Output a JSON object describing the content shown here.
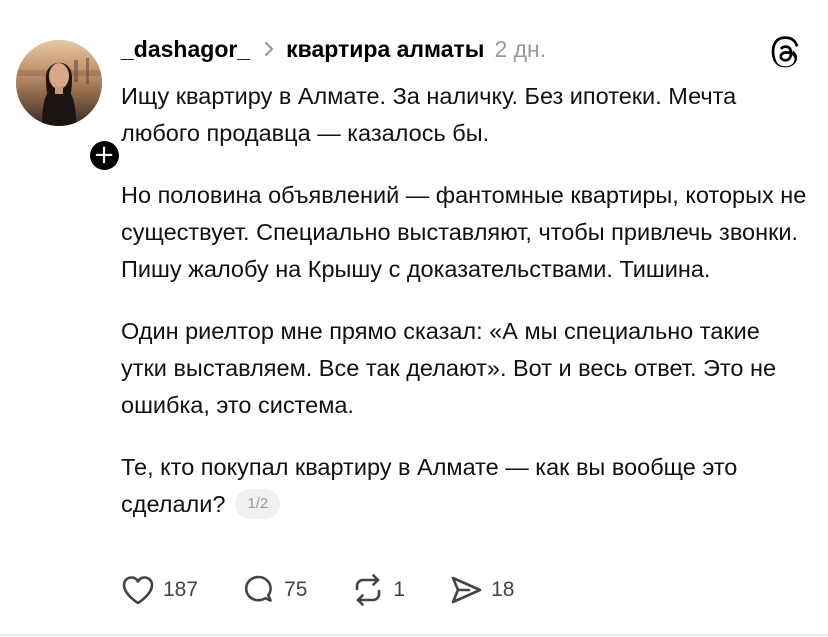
{
  "post": {
    "username": "_dashagor_",
    "topic": "квартира алматы",
    "time": "2 дн.",
    "paragraphs": [
      "Ищу квартиру в Алмате. За наличку. Без ипотеки. Мечта любого продавца — казалось бы.",
      "Но половина объявлений — фантомные квартиры, которых не существует. Специально выставляют, чтобы привлечь звонки. Пишу жалобу на Крышу с доказательствами. Тишина.",
      "Один риелтор мне прямо сказал: «А мы специально такие утки выставляем. Все так делают». Вот и весь ответ. Это не ошибка, это система.",
      "Те, кто покупал квартиру в Алмате — как вы вообще это сделали?"
    ],
    "page_indicator": "1/2"
  },
  "actions": {
    "likes": "187",
    "comments": "75",
    "reposts": "1",
    "shares": "18"
  },
  "icons": {
    "follow": "plus-icon",
    "chevron": "chevron-right-icon",
    "app": "threads-logo-icon",
    "like": "heart-icon",
    "comment": "comment-bubble-icon",
    "repost": "repost-icon",
    "share": "share-send-icon"
  },
  "colors": {
    "text": "#111111",
    "muted": "#999999",
    "action": "#444444"
  }
}
